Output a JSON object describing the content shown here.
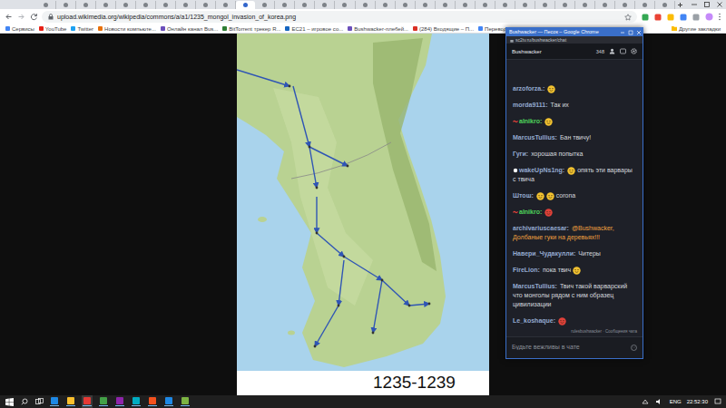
{
  "browser": {
    "tabs": [
      {
        "selected": false
      },
      {
        "selected": false
      },
      {
        "selected": false
      },
      {
        "selected": false
      },
      {
        "selected": false
      },
      {
        "selected": false
      },
      {
        "selected": false
      },
      {
        "selected": false
      },
      {
        "selected": false
      },
      {
        "selected": false
      },
      {
        "selected": true
      },
      {
        "selected": false
      },
      {
        "selected": false
      },
      {
        "selected": false
      },
      {
        "selected": false
      },
      {
        "selected": false
      },
      {
        "selected": false
      },
      {
        "selected": false
      },
      {
        "selected": false
      },
      {
        "selected": false
      },
      {
        "selected": false
      },
      {
        "selected": false
      },
      {
        "selected": false
      },
      {
        "selected": false
      },
      {
        "selected": false
      },
      {
        "selected": false
      },
      {
        "selected": false
      },
      {
        "selected": false
      },
      {
        "selected": false
      },
      {
        "selected": false
      },
      {
        "selected": false
      },
      {
        "selected": false
      }
    ],
    "address": "upload.wikimedia.org/wikipedia/commons/a/a1/1235_mongol_invasion_of_korea.png",
    "bookmarks": [
      {
        "label": "Сервисы",
        "color": "#4285f4"
      },
      {
        "label": "YouTube",
        "color": "#e62117"
      },
      {
        "label": "Twitter",
        "color": "#1da1f2"
      },
      {
        "label": "Новости компьюте...",
        "color": "#e8710a"
      },
      {
        "label": "Онлайн канал Bus...",
        "color": "#6b4fbb"
      },
      {
        "label": "BitTorrent трекер R...",
        "color": "#2e7d32"
      },
      {
        "label": "EC21 – игровое со...",
        "color": "#1565c0"
      },
      {
        "label": "Bushwacker-плебей...",
        "color": "#6b4fbb"
      },
      {
        "label": "(284) Входящие – П...",
        "color": "#d93025"
      },
      {
        "label": "Переводчик Google",
        "color": "#4285f4"
      }
    ],
    "other_bookmarks": "Другие закладки"
  },
  "map": {
    "caption": "1235-1239"
  },
  "chat_window": {
    "title": "Bushwacker — Песок – Google Chrome",
    "url": "sc2tv.ru/bushwacker/chat",
    "channel": "Bushwacker",
    "viewers": "348",
    "messages": [
      {
        "user": "arzoforza.:",
        "color": "#93a9cf",
        "parts": [
          {
            "kind": "emote",
            "color": "#f2c230"
          }
        ]
      },
      {
        "user": "morda9111:",
        "color": "#93a9cf",
        "parts": [
          {
            "kind": "text",
            "text": "Так их",
            "color": "#d5d8de"
          }
        ]
      },
      {
        "user": "alnikro:",
        "color": "#4fd35c",
        "badge": {
          "kind": "tilde",
          "color": "#e0413a"
        },
        "parts": [
          {
            "kind": "emote",
            "color": "#f2c230"
          }
        ]
      },
      {
        "user": "MarcusTullius:",
        "color": "#93a9cf",
        "parts": [
          {
            "kind": "text",
            "text": "Бан твичу!",
            "color": "#d5d8de"
          }
        ]
      },
      {
        "user": "Гуги:",
        "color": "#93a9cf",
        "parts": [
          {
            "kind": "text",
            "text": "хорошая попытка",
            "color": "#d5d8de"
          }
        ]
      },
      {
        "user": "wakeUpNs1ng:",
        "color": "#93a9cf",
        "badge": {
          "kind": "dot",
          "color": "#ffffff"
        },
        "parts": [
          {
            "kind": "emote",
            "color": "#f2c230"
          },
          {
            "kind": "text",
            "text": "опять эти варвары с твича",
            "color": "#d5d8de"
          }
        ]
      },
      {
        "user": "Штош:",
        "color": "#93a9cf",
        "parts": [
          {
            "kind": "emote",
            "color": "#f2c230"
          },
          {
            "kind": "emote",
            "color": "#f2c230"
          },
          {
            "kind": "text",
            "text": "corona",
            "color": "#d5d8de"
          }
        ]
      },
      {
        "user": "alnikro:",
        "color": "#4fd35c",
        "badge": {
          "kind": "tilde",
          "color": "#e0413a"
        },
        "parts": [
          {
            "kind": "emote",
            "color": "#e0413a"
          }
        ]
      },
      {
        "user": "archivariuscaesar:",
        "color": "#93a9cf",
        "parts": [
          {
            "kind": "text",
            "text": "@Bushwacker, Долбаные гуки на деревьях!!!",
            "color": "#f0a040"
          }
        ]
      },
      {
        "user": "Навери_Чудакулли:",
        "color": "#93a9cf",
        "parts": [
          {
            "kind": "text",
            "text": "Читеры",
            "color": "#d5d8de"
          }
        ]
      },
      {
        "user": "FireLion:",
        "color": "#93a9cf",
        "parts": [
          {
            "kind": "text",
            "text": "пока твич",
            "color": "#d5d8de"
          },
          {
            "kind": "emote",
            "color": "#f2c230"
          }
        ]
      },
      {
        "user": "MarcusTullius:",
        "color": "#93a9cf",
        "parts": [
          {
            "kind": "text",
            "text": "Твич такой варварский что монголы рядом с ним образец цивилизации",
            "color": "#d5d8de"
          }
        ]
      },
      {
        "user": "Le_koshaque:",
        "color": "#93a9cf",
        "parts": [
          {
            "kind": "emote",
            "color": "#e0413a"
          }
        ]
      }
    ],
    "footer": "rulesbushwacker · Сообщения чата",
    "input_placeholder": "Будьте вежливы в чате"
  },
  "taskbar": {
    "language": "ENG",
    "time": "22:52:30"
  }
}
